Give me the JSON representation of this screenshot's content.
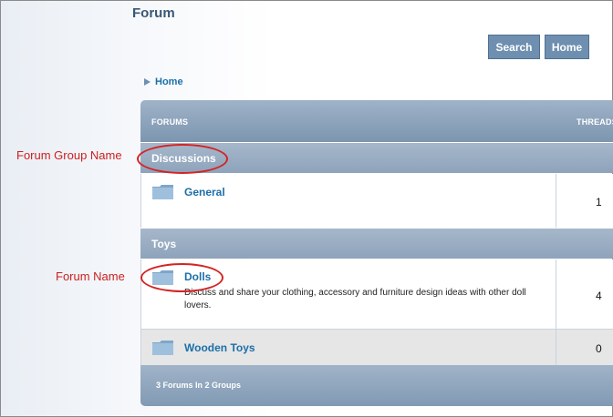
{
  "page": {
    "title": "Forum"
  },
  "toolbar": {
    "search_label": "Search",
    "home_label": "Home"
  },
  "breadcrumb": {
    "home_label": "Home"
  },
  "table": {
    "headers": {
      "forums": "FORUMS",
      "threads": "THREADS"
    },
    "groups": [
      {
        "name": "Discussions",
        "forums": [
          {
            "name": "General",
            "description": "",
            "threads": "1",
            "shaded": false
          }
        ]
      },
      {
        "name": "Toys",
        "forums": [
          {
            "name": "Dolls",
            "description": "Discuss and share your clothing, accessory and furniture design ideas with other doll lovers.",
            "threads": "4",
            "shaded": false
          },
          {
            "name": "Wooden Toys",
            "description": "",
            "threads": "0",
            "shaded": true
          }
        ]
      }
    ],
    "footer": "3 Forums In 2 Groups"
  },
  "annotations": {
    "group_callout": "Forum Group Name",
    "forum_callout": "Forum Name"
  },
  "colors": {
    "accent": "#1b6fa8",
    "header_blue": "#7d95b0",
    "callout_red": "#cc1f1f"
  }
}
